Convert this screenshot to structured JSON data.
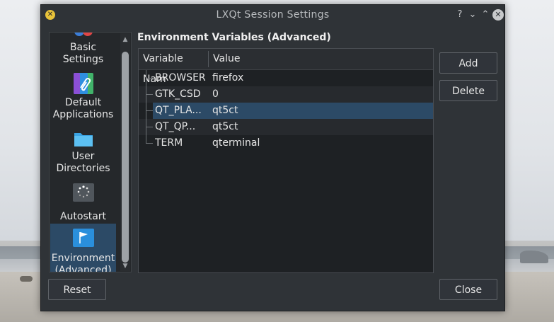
{
  "window": {
    "title": "LXQt Session Settings",
    "titlebar_buttons": [
      "?",
      "⌄",
      "⌃",
      "✕"
    ]
  },
  "sidebar": {
    "items": [
      {
        "label": "Basic Settings",
        "icon": "basic-settings-icon"
      },
      {
        "label": "Default Applications",
        "icon": "default-applications-icon"
      },
      {
        "label": "User Directories",
        "icon": "folder-icon"
      },
      {
        "label": "Autostart",
        "icon": "autostart-icon"
      },
      {
        "label": "Environment (Advanced)",
        "icon": "environment-flag-icon",
        "selected": true
      }
    ]
  },
  "main": {
    "section_title": "Environment Variables (Advanced)",
    "columns": [
      "Variable Nam",
      "Value"
    ],
    "rows": [
      {
        "name": "BROWSER",
        "value": "firefox"
      },
      {
        "name": "GTK_CSD",
        "value": "0"
      },
      {
        "name": "QT_PLA...",
        "value": "qt5ct",
        "selected": true
      },
      {
        "name": "QT_QP...",
        "value": "qt5ct"
      },
      {
        "name": "TERM",
        "value": "qterminal"
      }
    ],
    "add_label": "Add",
    "delete_label": "Delete"
  },
  "footer": {
    "reset_label": "Reset",
    "close_label": "Close"
  },
  "colors": {
    "window_bg": "#2f3337",
    "selection": "#2c4a66",
    "app_icon": "#e8c33a"
  }
}
